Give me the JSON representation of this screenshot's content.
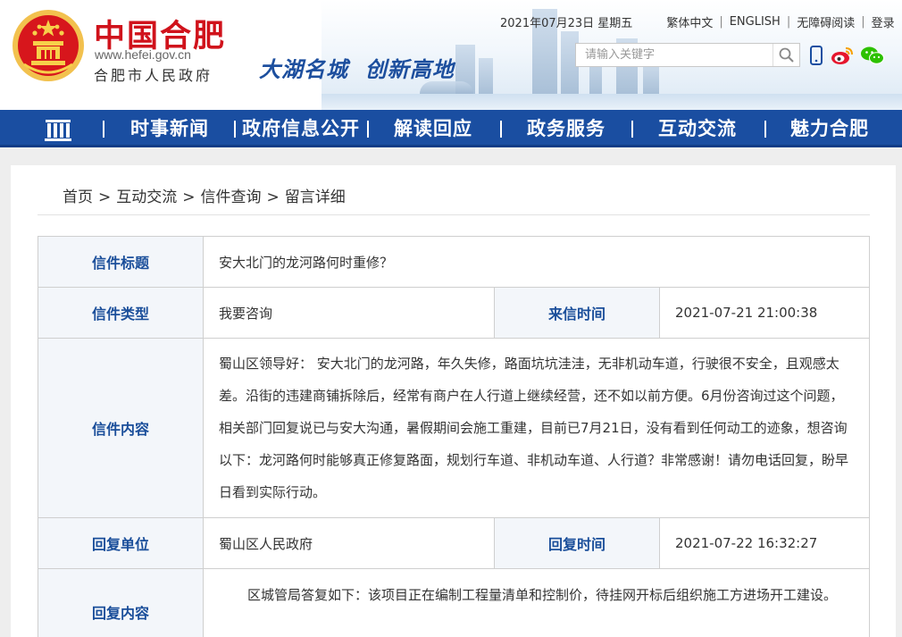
{
  "header": {
    "site_title": "中国合肥",
    "site_url": "www.hefei.gov.cn",
    "site_gov": "合肥市人民政府",
    "slogan": "大湖名城  创新高地",
    "date": "2021年07月23日 星期五",
    "links": [
      "繁体中文",
      "ENGLISH",
      "无障碍阅读",
      "登录"
    ],
    "search_placeholder": "请输入关键字",
    "colors": {
      "brand_red": "#d0121b",
      "nav_blue": "#1a4ea1",
      "label_blue": "#1a4e9a"
    }
  },
  "nav": {
    "items": [
      "时事新闻",
      "政府信息公开",
      "解读回应",
      "政务服务",
      "互动交流",
      "魅力合肥"
    ]
  },
  "breadcrumb": [
    "首页",
    "互动交流",
    "信件查询",
    "留言详细"
  ],
  "letter": {
    "title_label": "信件标题",
    "title_value": "安大北门的龙河路何时重修？",
    "type_label": "信件类型",
    "type_value": "我要咨询",
    "time_label": "来信时间",
    "time_value": "2021-07-21 21:00:38",
    "content_label": "信件内容",
    "content_value": "蜀山区领导好： 安大北门的龙河路，年久失修，路面坑坑洼洼，无非机动车道，行驶很不安全，且观感太差。沿街的违建商铺拆除后，经常有商户在人行道上继续经营，还不如以前方便。6月份咨询过这个问题，相关部门回复说已与安大沟通，暑假期间会施工重建，目前已7月21日，没有看到任何动工的迹象，想咨询以下：龙河路何时能够真正修复路面，规划行车道、非机动车道、人行道？非常感谢！请勿电话回复，盼早日看到实际行动。",
    "reply_unit_label": "回复单位",
    "reply_unit_value": "蜀山区人民政府",
    "reply_time_label": "回复时间",
    "reply_time_value": "2021-07-22 16:32:27",
    "reply_content_label": "回复内容",
    "reply_content_value": "区城管局答复如下：该项目正在编制工程量清单和控制价，待挂网开标后组织施工方进场开工建设。"
  }
}
